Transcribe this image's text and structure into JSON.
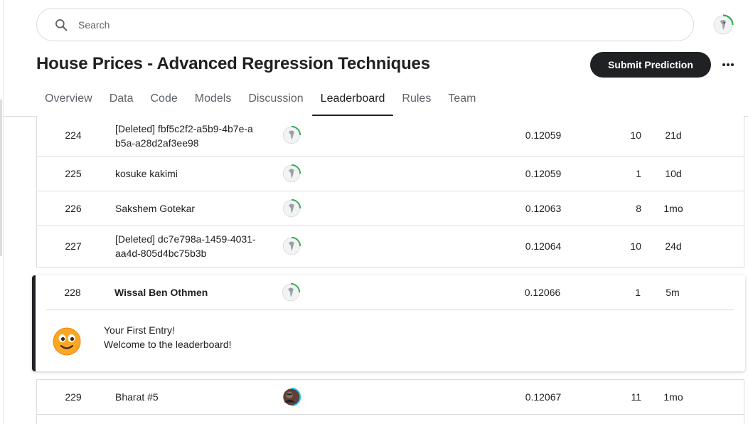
{
  "search": {
    "placeholder": "Search"
  },
  "competition": {
    "title": "House Prices - Advanced Regression Techniques"
  },
  "header": {
    "submit_label": "Submit Prediction",
    "more_label": "•••"
  },
  "tabs": [
    {
      "label": "Overview",
      "active": false
    },
    {
      "label": "Data",
      "active": false
    },
    {
      "label": "Code",
      "active": false
    },
    {
      "label": "Models",
      "active": false
    },
    {
      "label": "Discussion",
      "active": false
    },
    {
      "label": "Leaderboard",
      "active": true
    },
    {
      "label": "Rules",
      "active": false
    },
    {
      "label": "Team",
      "active": false
    }
  ],
  "leaderboard": {
    "rows_above": [
      {
        "rank": "224",
        "team": "[Deleted] fbf5c2f2-a5b9-4b7e-ab5a-a28d2af3ee98",
        "score": "0.12059",
        "entries": "10",
        "last": "21d",
        "avatar": "default-avatar"
      },
      {
        "rank": "225",
        "team": "kosuke kakimi",
        "score": "0.12059",
        "entries": "1",
        "last": "10d",
        "avatar": "default-avatar"
      },
      {
        "rank": "226",
        "team": "Sakshem Gotekar",
        "score": "0.12063",
        "entries": "8",
        "last": "1mo",
        "avatar": "default-avatar"
      },
      {
        "rank": "227",
        "team": "[Deleted] dc7e798a-1459-4031-aa4d-805d4bc75b3b",
        "score": "0.12064",
        "entries": "10",
        "last": "24d",
        "avatar": "default-avatar"
      }
    ],
    "my_entry": {
      "rank": "228",
      "team": "Wissal Ben Othmen",
      "score": "0.12066",
      "entries": "1",
      "last": "5m",
      "message_line1": "Your First Entry!",
      "message_line2": "Welcome to the leaderboard!",
      "emoji": "smiling-face-emoji"
    },
    "rows_below": [
      {
        "rank": "229",
        "team": "Bharat #5",
        "score": "0.12067",
        "entries": "11",
        "last": "1mo",
        "avatar": "photo-avatar"
      }
    ]
  },
  "colors": {
    "accent_dark": "#202124",
    "progress_green": "#20beff",
    "ring_green": "#34a853",
    "ring_blue": "#20beff"
  }
}
